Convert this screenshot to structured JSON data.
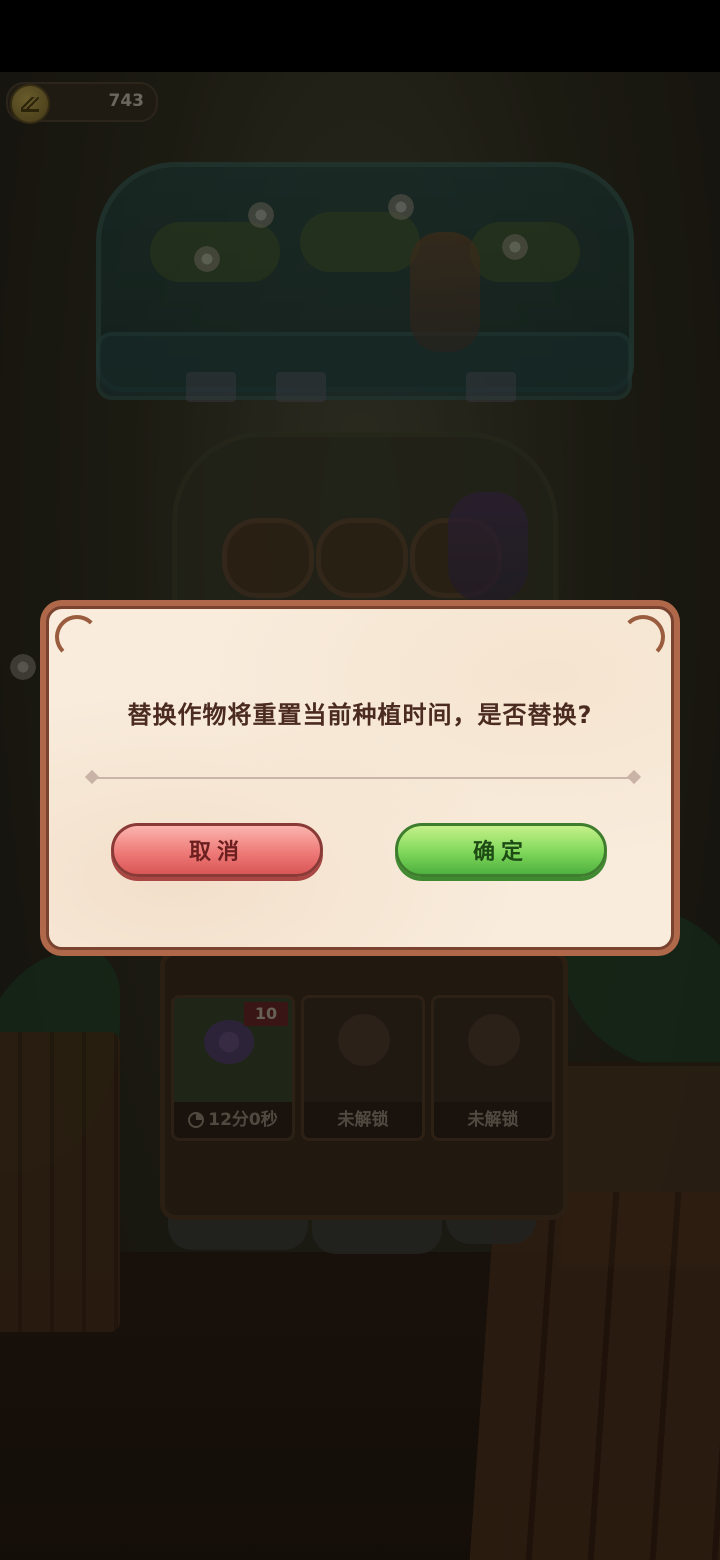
{
  "hud": {
    "coin_value": "743"
  },
  "field": {
    "slots": [
      {
        "badge": "10",
        "label": "12分0秒"
      },
      {
        "label": "未解锁"
      },
      {
        "label": "未解锁"
      }
    ]
  },
  "dialog": {
    "message": "替换作物将重置当前种植时间，是否替换?",
    "cancel_label": "取消",
    "confirm_label": "确定"
  },
  "colors": {
    "dialog_frame": "#b0684a",
    "dialog_background": "#f9ecdc",
    "cancel_button": "#ee7b78",
    "confirm_button": "#7fd75a",
    "message_text": "#4b2b20"
  }
}
